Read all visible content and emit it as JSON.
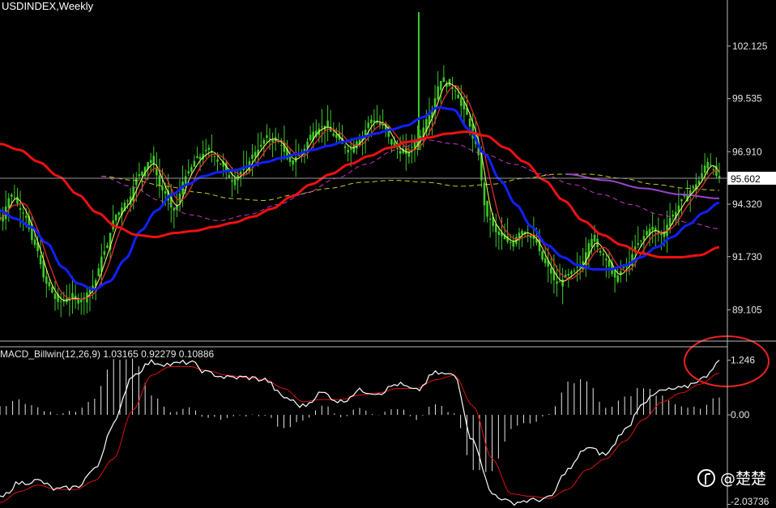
{
  "chart_data": [
    {
      "type": "candlestick-line",
      "title": "USDINDEX,Weekly",
      "y_ticks": [
        "102.125",
        "99.535",
        "96.910",
        "94.320",
        "91.730",
        "89.105"
      ],
      "y_tick_values": [
        102.125,
        99.535,
        96.91,
        94.32,
        91.73,
        89.105
      ],
      "ylim": [
        87.6,
        104.4
      ],
      "current_price": 95.602,
      "current_price_label": "95.602",
      "colors": {
        "candles": "#3cc82a",
        "ma_fast": "#ffff66",
        "ma_medium": "#e03030",
        "ma_blue": "#1020ff",
        "ma_red": "#ee1111",
        "ma_magenta_dash": "#cc33cc",
        "ma_yellow_dash": "#cccc22",
        "ma_purple": "#9944cc"
      },
      "price_series": [
        93.6,
        94.8,
        93.9,
        92.3,
        90.4,
        89.5,
        89.7,
        89.6,
        90.3,
        92.0,
        93.8,
        94.5,
        95.8,
        96.5,
        95.0,
        94.0,
        95.7,
        96.6,
        97.0,
        96.3,
        95.5,
        96.0,
        96.9,
        97.6,
        97.4,
        96.4,
        96.9,
        97.9,
        98.2,
        97.6,
        97.0,
        97.5,
        98.5,
        98.2,
        97.1,
        96.8,
        97.5,
        98.7,
        100.4,
        100.1,
        99.0,
        97.3,
        93.7,
        92.8,
        92.4,
        93.0,
        92.6,
        91.4,
        90.4,
        90.8,
        91.3,
        92.6,
        91.8,
        90.7,
        91.3,
        92.4,
        93.1,
        92.8,
        93.8,
        94.7,
        95.3,
        96.4,
        95.6
      ],
      "ma_blue_series": [
        94.0,
        93.6,
        93.2,
        92.4,
        91.2,
        90.4,
        90.1,
        90.5,
        91.6,
        93.0,
        94.0,
        94.8,
        95.3,
        95.7,
        95.9,
        96.0,
        96.2,
        96.4,
        96.6,
        96.8,
        97.0,
        97.2,
        97.4,
        97.6,
        97.8,
        98.0,
        98.2,
        98.6,
        99.1,
        99.0,
        98.0,
        96.8,
        95.5,
        94.3,
        93.2,
        92.3,
        91.7,
        91.3,
        91.1,
        91.1,
        91.3,
        91.7,
        92.2,
        92.7,
        93.3,
        93.9,
        94.4
      ],
      "ma_red_series": [
        97.3,
        97.0,
        96.4,
        95.7,
        94.8,
        93.9,
        93.2,
        92.8,
        92.7,
        92.9,
        93.0,
        93.2,
        93.4,
        93.7,
        94.1,
        94.7,
        95.3,
        95.8,
        96.3,
        96.7,
        97.1,
        97.4,
        97.6,
        97.8,
        97.9,
        97.7,
        97.1,
        96.4,
        95.5,
        94.5,
        93.5,
        92.8,
        92.3,
        91.9,
        91.7,
        91.7,
        91.8,
        92.2
      ]
    },
    {
      "type": "macd",
      "title": "MACD_Billwin(12,26,9) 1.03165 0.92279 0.10886",
      "y_ticks": [
        "1.246",
        "0.00",
        "-2.03736"
      ],
      "y_tick_values": [
        1.246,
        0.0,
        -2.03736
      ],
      "ylim": [
        -2.12,
        1.55
      ],
      "macd_value": 1.03165,
      "signal_value": 0.92279,
      "histogram_value": 0.10886,
      "colors": {
        "macd_line": "#ffffff",
        "signal_line": "#dd1111",
        "histogram": "#e6e6e6",
        "highlight": "#ee2222"
      },
      "macd_series": [
        -1.9,
        -1.55,
        -1.5,
        -1.7,
        -1.65,
        -1.25,
        -0.2,
        0.9,
        1.2,
        1.15,
        1.2,
        0.95,
        0.85,
        0.85,
        0.8,
        0.4,
        0.2,
        0.5,
        0.3,
        0.55,
        0.5,
        0.7,
        0.55,
        0.95,
        0.9,
        -0.6,
        -1.8,
        -2.0,
        -1.95,
        -1.9,
        -1.25,
        -0.75,
        -0.9,
        -0.35,
        0.3,
        0.55,
        0.6,
        0.8,
        1.2
      ],
      "signal_series": [
        -2.0,
        -1.75,
        -1.6,
        -1.7,
        -1.7,
        -1.5,
        -1.0,
        0.1,
        0.9,
        1.1,
        1.1,
        1.0,
        0.9,
        0.85,
        0.8,
        0.6,
        0.3,
        0.35,
        0.35,
        0.45,
        0.5,
        0.6,
        0.6,
        0.8,
        0.9,
        0.2,
        -1.0,
        -1.8,
        -1.85,
        -1.9,
        -1.7,
        -1.25,
        -1.0,
        -0.6,
        -0.1,
        0.3,
        0.5,
        0.7,
        0.95
      ]
    }
  ],
  "watermark": {
    "text": "@楚楚",
    "icon": "facebook-circle-icon"
  }
}
